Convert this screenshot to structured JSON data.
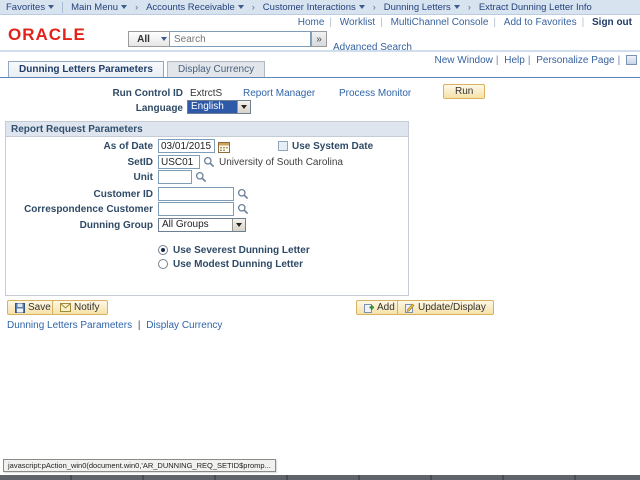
{
  "ui": {
    "crumb_sep": "›",
    "pipe": "|"
  },
  "breadcrumb": {
    "favorites": "Favorites",
    "main_menu": "Main Menu",
    "items": [
      "Accounts Receivable",
      "Customer Interactions",
      "Dunning Letters",
      "Extract Dunning Letter Info"
    ]
  },
  "header": {
    "utility_links": [
      "Home",
      "Worklist",
      "MultiChannel Console",
      "Add to Favorites"
    ],
    "sign_out": "Sign out",
    "logo": "ORACLE",
    "search": {
      "scope": "All",
      "placeholder": "Search",
      "go_glyph": "»",
      "advanced": "Advanced Search"
    },
    "page_links": [
      "New Window",
      "Help",
      "Personalize Page"
    ]
  },
  "tabs": [
    {
      "label": "Dunning Letters Parameters"
    },
    {
      "label": "Display Currency"
    }
  ],
  "run_control": {
    "label": "Run Control ID",
    "value": "ExtrctS",
    "report_manager": "Report Manager",
    "process_monitor": "Process Monitor",
    "run_button": "Run",
    "language_label": "Language",
    "language_value": "English"
  },
  "form": {
    "group_title": "Report Request Parameters",
    "as_of_date": {
      "label": "As of Date",
      "value": "03/01/2015"
    },
    "use_system_date_label": "Use System Date",
    "setid": {
      "label": "SetID",
      "value": "USC01",
      "description": "University of South Carolina"
    },
    "unit_label": "Unit",
    "customer_id_label": "Customer ID",
    "correspondence_customer_label": "Correspondence Customer",
    "dunning_group": {
      "label": "Dunning Group",
      "value": "All Groups"
    },
    "radio_severest": "Use Severest Dunning Letter",
    "radio_modest": "Use Modest Dunning Letter"
  },
  "toolbar": {
    "save": "Save",
    "notify": "Notify",
    "add": "Add",
    "update_display": "Update/Display"
  },
  "footer_links": [
    "Dunning Letters Parameters",
    "Display Currency"
  ],
  "status_bar": "javascript:pAction_win0(document.win0,'AR_DUNNING_REQ_SETID$promp...",
  "colors": {
    "link_blue": "#2e64a8",
    "oracle_red": "#e2231a",
    "bar_blue": "#d8e3f0",
    "button_tan": "#f6e2a8",
    "focus_highlight": "#2e59a8"
  }
}
